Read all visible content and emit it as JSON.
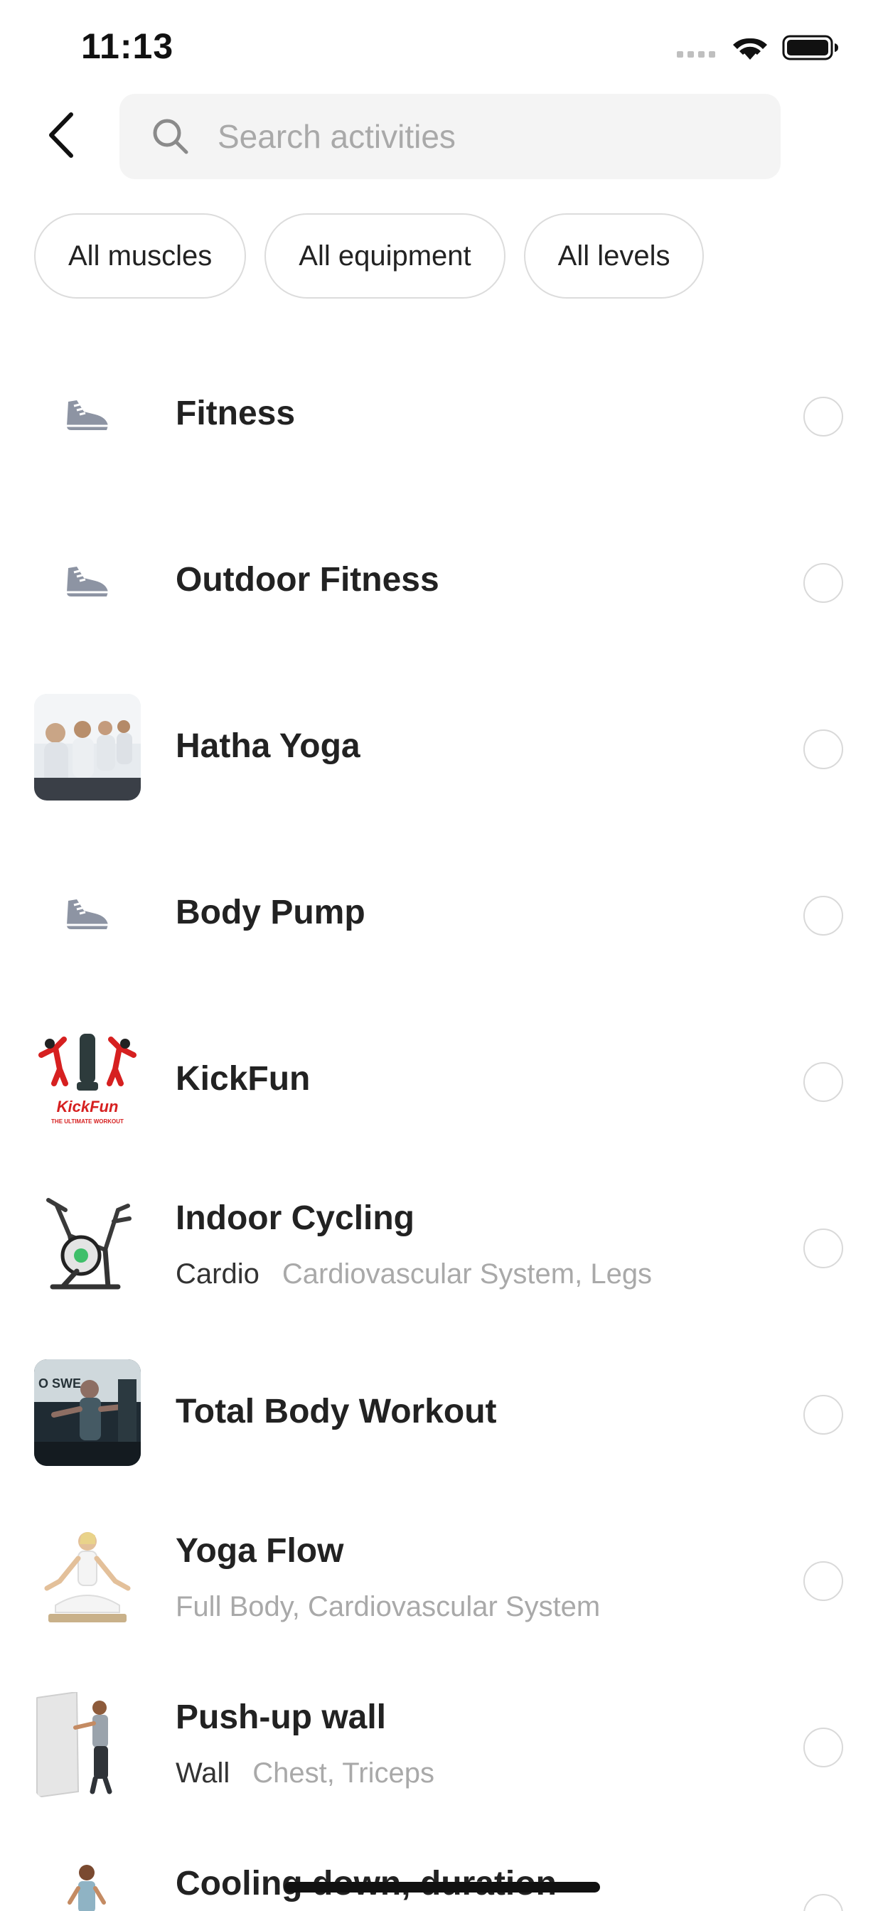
{
  "status_bar": {
    "time": "11:13"
  },
  "search": {
    "placeholder": "Search activities",
    "value": ""
  },
  "filters": [
    {
      "label": "All muscles"
    },
    {
      "label": "All equipment"
    },
    {
      "label": "All levels"
    }
  ],
  "activities": [
    {
      "title": "Fitness",
      "equipment": "",
      "muscles": "",
      "thumb": "shoe-icon",
      "selected": false
    },
    {
      "title": "Outdoor Fitness",
      "equipment": "",
      "muscles": "",
      "thumb": "shoe-icon",
      "selected": false
    },
    {
      "title": "Hatha Yoga",
      "equipment": "",
      "muscles": "",
      "thumb": "photo",
      "selected": false
    },
    {
      "title": "Body Pump",
      "equipment": "",
      "muscles": "",
      "thumb": "shoe-icon",
      "selected": false
    },
    {
      "title": "KickFun",
      "equipment": "",
      "muscles": "",
      "thumb": "logo",
      "logo_text": "KickFun",
      "logo_tagline": "THE ULTIMATE WORKOUT",
      "selected": false
    },
    {
      "title": "Indoor Cycling",
      "equipment": "Cardio",
      "muscles": "Cardiovascular System, Legs",
      "thumb": "bike",
      "selected": false
    },
    {
      "title": "Total Body Workout",
      "equipment": "",
      "muscles": "",
      "thumb": "photo",
      "selected": false
    },
    {
      "title": "Yoga Flow",
      "equipment": "",
      "muscles": "Full Body, Cardiovascular System",
      "thumb": "figure",
      "selected": false
    },
    {
      "title": "Push-up wall",
      "equipment": "Wall",
      "muscles": "Chest, Triceps",
      "thumb": "figure",
      "selected": false
    },
    {
      "title": "Cooling down, duration",
      "equipment": "",
      "muscles": "",
      "thumb": "figure",
      "selected": false
    }
  ],
  "colors": {
    "accent_text": "#222222",
    "muted_text": "#a9a9a9",
    "chip_border": "#dcdcdc",
    "search_bg": "#f4f4f4",
    "shoe_icon": "#8d94a3"
  }
}
